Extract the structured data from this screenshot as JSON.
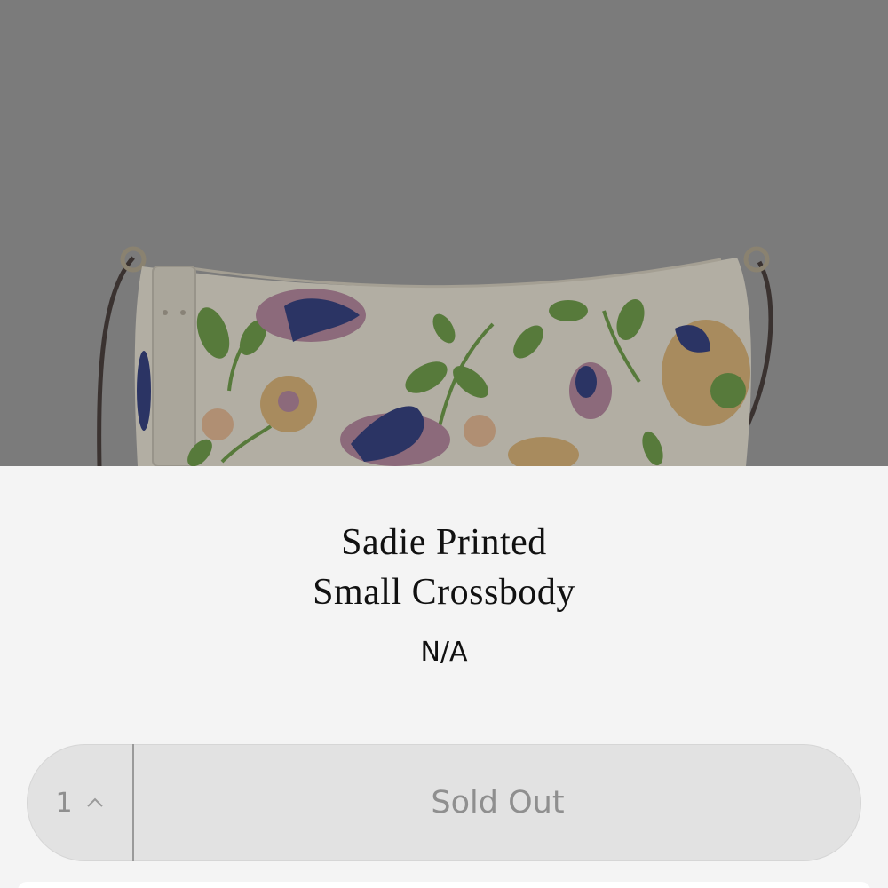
{
  "product": {
    "image_alt": "floral crossbody bag",
    "title_line1": "Sadie Printed",
    "title_line2": "Small Crossbody",
    "price": "N/A"
  },
  "cart": {
    "quantity": "1",
    "button_label": "Sold Out"
  },
  "colors": {
    "overlay": "#7b7b7b",
    "background": "#f4f4f4",
    "button_bg": "#e2e2e2",
    "disabled_text": "#8f8f8f"
  }
}
